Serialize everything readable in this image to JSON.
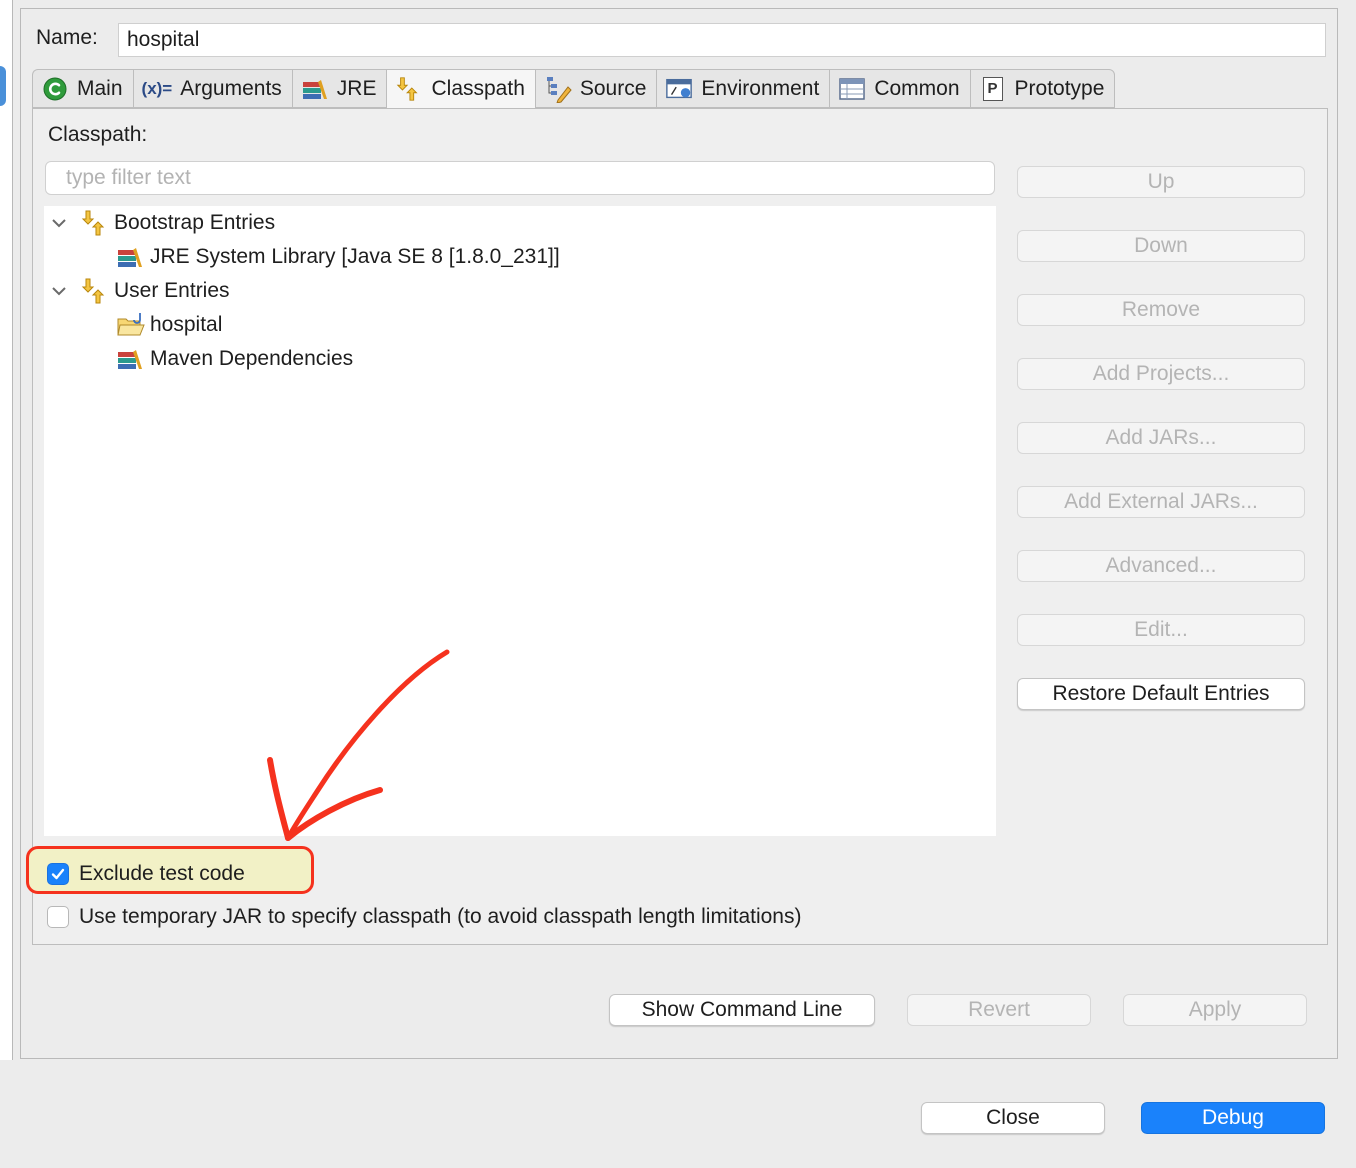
{
  "name_field": {
    "label": "Name:",
    "value": "hospital"
  },
  "tabs": [
    {
      "label": "Main",
      "icon": "main-c-icon",
      "active": false
    },
    {
      "label": "Arguments",
      "icon": "arguments-x-icon",
      "active": false
    },
    {
      "label": "JRE",
      "icon": "jre-library-icon",
      "active": false
    },
    {
      "label": "Classpath",
      "icon": "classpath-icon",
      "active": true
    },
    {
      "label": "Source",
      "icon": "source-icon",
      "active": false
    },
    {
      "label": "Environment",
      "icon": "environment-icon",
      "active": false
    },
    {
      "label": "Common",
      "icon": "common-table-icon",
      "active": false
    },
    {
      "label": "Prototype",
      "icon": "prototype-p-icon",
      "active": false
    }
  ],
  "tab_icon_text": {
    "arguments": "(x)=",
    "prototype": "P"
  },
  "classpath": {
    "label": "Classpath:",
    "filter_placeholder": "type filter text",
    "tree": [
      {
        "label": "Bootstrap Entries",
        "icon": "classpath-entries-icon",
        "expanded": true
      },
      {
        "label": "JRE System Library [Java SE 8 [1.8.0_231]]",
        "icon": "library-icon"
      },
      {
        "label": "User Entries",
        "icon": "classpath-entries-icon",
        "expanded": true
      },
      {
        "label": "hospital",
        "icon": "project-folder-icon"
      },
      {
        "label": "Maven Dependencies",
        "icon": "library-icon"
      }
    ]
  },
  "side_buttons": [
    {
      "label": "Up",
      "enabled": false
    },
    {
      "label": "Down",
      "enabled": false
    },
    {
      "label": "Remove",
      "enabled": false
    },
    {
      "label": "Add Projects...",
      "enabled": false
    },
    {
      "label": "Add JARs...",
      "enabled": false
    },
    {
      "label": "Add External JARs...",
      "enabled": false
    },
    {
      "label": "Advanced...",
      "enabled": false
    },
    {
      "label": "Edit...",
      "enabled": false
    },
    {
      "label": "Restore Default Entries",
      "enabled": true
    }
  ],
  "options": {
    "exclude_test_code": {
      "label": "Exclude test code",
      "checked": true
    },
    "temp_jar": {
      "label": "Use temporary JAR to specify classpath (to avoid classpath length limitations)",
      "checked": false
    }
  },
  "bottom_buttons": {
    "show_command_line": "Show Command Line",
    "revert": "Revert",
    "apply": "Apply"
  },
  "dialog_buttons": {
    "close": "Close",
    "debug": "Debug"
  },
  "colors": {
    "accent": "#1a82fb",
    "annotation_red": "#f5321e",
    "highlight_fill": "#f2f1c6",
    "disabled_text": "#b4b4b4"
  }
}
